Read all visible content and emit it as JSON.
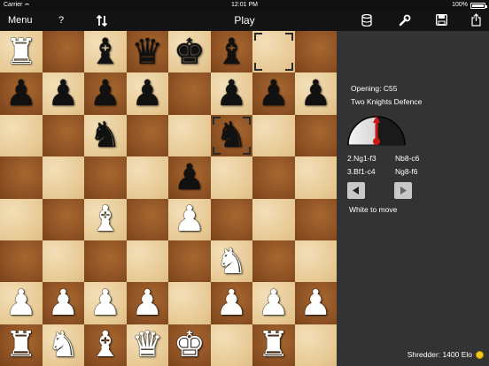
{
  "status_bar": {
    "carrier": "Carrier",
    "time": "12:01 PM",
    "battery": "100%"
  },
  "toolbar": {
    "menu_label": "Menu",
    "help_label": "?",
    "title": "Play",
    "icons": [
      "swap-arrows-icon",
      "database-icon",
      "wrench-icon",
      "save-icon",
      "share-icon"
    ]
  },
  "board": {
    "squares": [
      [
        "wR",
        "",
        "bB",
        "bQ",
        "bK",
        "bB",
        "",
        ""
      ],
      [
        "bP",
        "bP",
        "bP",
        "bP",
        "",
        "bP",
        "bP",
        "bP"
      ],
      [
        "",
        "",
        "bN",
        "",
        "",
        "bN",
        "",
        ""
      ],
      [
        "",
        "",
        "",
        "",
        "bP",
        "",
        "",
        ""
      ],
      [
        "",
        "",
        "wB",
        "",
        "wP",
        "",
        "",
        ""
      ],
      [
        "",
        "",
        "",
        "",
        "",
        "wN",
        "",
        ""
      ],
      [
        "wP",
        "wP",
        "wP",
        "wP",
        "",
        "wP",
        "wP",
        "wP"
      ],
      [
        "wR",
        "wN",
        "wB",
        "wQ",
        "wK",
        "",
        "wR",
        ""
      ]
    ],
    "highlights": [
      [
        0,
        6
      ],
      [
        2,
        5
      ]
    ],
    "colors": {
      "light": "#e7c994",
      "dark": "#8c5023"
    }
  },
  "panel": {
    "opening_code": "Opening: C55",
    "opening_name": "Two Knights Defence",
    "moves": [
      [
        "2.Ng1-f3",
        "Nb8-c6"
      ],
      [
        "3.Bf1-c4",
        "Ng8-f6"
      ]
    ],
    "turn_text": "White to move",
    "engine": "Shredder: 1400 Elo",
    "gauge_value": 0.5
  }
}
